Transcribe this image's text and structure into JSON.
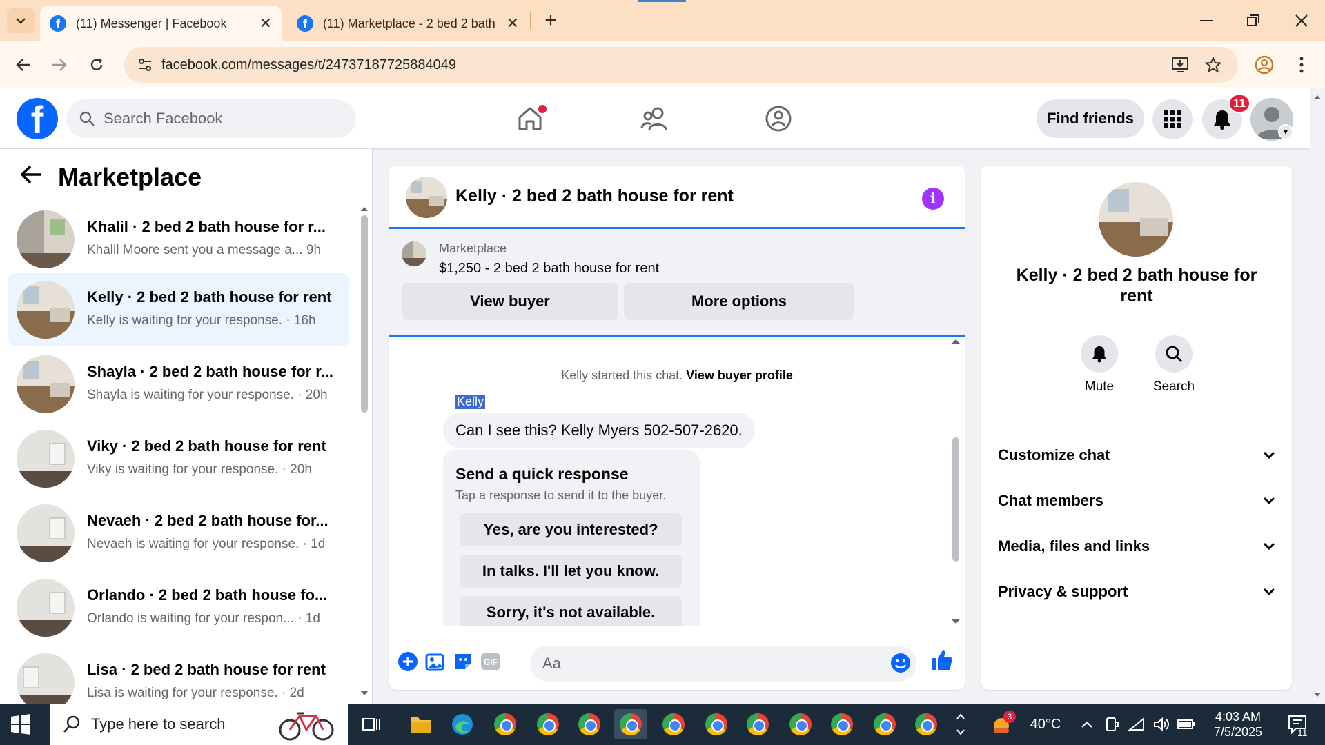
{
  "browser": {
    "tabs": [
      {
        "title": "(11) Messenger | Facebook",
        "active": true
      },
      {
        "title": "(11) Marketplace - 2 bed 2 bath",
        "active": false
      }
    ],
    "url": "facebook.com/messages/t/24737187725884049"
  },
  "fb_header": {
    "search_placeholder": "Search Facebook",
    "find_friends_label": "Find friends",
    "notification_count": "11"
  },
  "sidebar": {
    "title": "Marketplace",
    "conversations": [
      {
        "title": "Khalil · 2 bed 2 bath house for r...",
        "subtitle": "Khalil Moore sent you a message a... 9h",
        "selected": false
      },
      {
        "title": "Kelly · 2 bed 2 bath house for rent",
        "subtitle": "Kelly is waiting for your response. · 16h",
        "selected": true
      },
      {
        "title": "Shayla · 2 bed 2 bath house for r...",
        "subtitle": "Shayla is waiting for your response. · 20h",
        "selected": false
      },
      {
        "title": "Viky · 2 bed 2 bath house for rent",
        "subtitle": "Viky is waiting for your response. · 20h",
        "selected": false
      },
      {
        "title": "Nevaeh · 2 bed 2 bath house for...",
        "subtitle": "Nevaeh is waiting for your response. · 1d",
        "selected": false
      },
      {
        "title": "Orlando · 2 bed 2 bath house fo...",
        "subtitle": "Orlando is waiting for your respon... · 1d",
        "selected": false
      },
      {
        "title": "Lisa · 2 bed 2 bath house for rent",
        "subtitle": "Lisa is waiting for your response. · 2d",
        "selected": false
      }
    ]
  },
  "chat": {
    "title": "Kelly · 2 bed 2 bath house for rent",
    "marketplace_label": "Marketplace",
    "listing": "$1,250 - 2 bed 2 bath house for rent",
    "view_buyer_label": "View buyer",
    "more_options_label": "More options",
    "started_text": "Kelly started this chat.",
    "view_buyer_profile_label": "View buyer profile",
    "sender_name": "Kelly",
    "message": "Can I see this?  Kelly Myers 502-507-2620.",
    "quick_response": {
      "title": "Send a quick response",
      "subtitle": "Tap a response to send it to the buyer.",
      "options": [
        "Yes, are you interested?",
        "In talks. I'll let you know.",
        "Sorry, it's not available."
      ]
    },
    "composer_placeholder": "Aa"
  },
  "right_panel": {
    "title": "Kelly · 2 bed 2 bath house for rent",
    "mute_label": "Mute",
    "search_label": "Search",
    "sections": [
      "Customize chat",
      "Chat members",
      "Media, files and links",
      "Privacy & support"
    ]
  },
  "taskbar": {
    "search_placeholder": "Type here to search",
    "weather_badge": "3",
    "temperature": "40°C",
    "time": "4:03 AM",
    "date": "7/5/2025",
    "notification_count": "11"
  },
  "colors": {
    "fb_blue": "#0866ff",
    "selected_bg": "#ebf5ff",
    "badge_red": "#e41e3f",
    "info_purple": "#a033ff",
    "messenger_blue": "#1877f2"
  }
}
